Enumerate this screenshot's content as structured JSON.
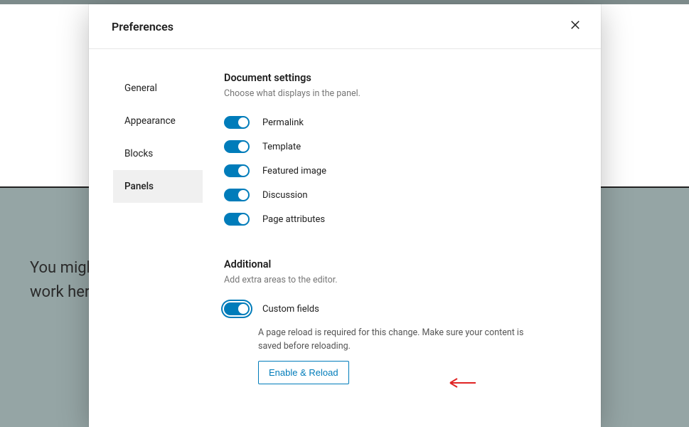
{
  "backdrop": {
    "line1": "You migh",
    "line2": "work here"
  },
  "modal": {
    "title": "Preferences"
  },
  "tabs": [
    {
      "label": "General"
    },
    {
      "label": "Appearance"
    },
    {
      "label": "Blocks"
    },
    {
      "label": "Panels"
    }
  ],
  "sections": {
    "document": {
      "heading": "Document settings",
      "description": "Choose what displays in the panel.",
      "items": [
        {
          "label": "Permalink",
          "on": true
        },
        {
          "label": "Template",
          "on": true
        },
        {
          "label": "Featured image",
          "on": true
        },
        {
          "label": "Discussion",
          "on": true
        },
        {
          "label": "Page attributes",
          "on": true
        }
      ]
    },
    "additional": {
      "heading": "Additional",
      "description": "Add extra areas to the editor.",
      "custom_fields_label": "Custom fields",
      "help": "A page reload is required for this change. Make sure your content is saved before reloading.",
      "reload_button": "Enable & Reload"
    }
  }
}
